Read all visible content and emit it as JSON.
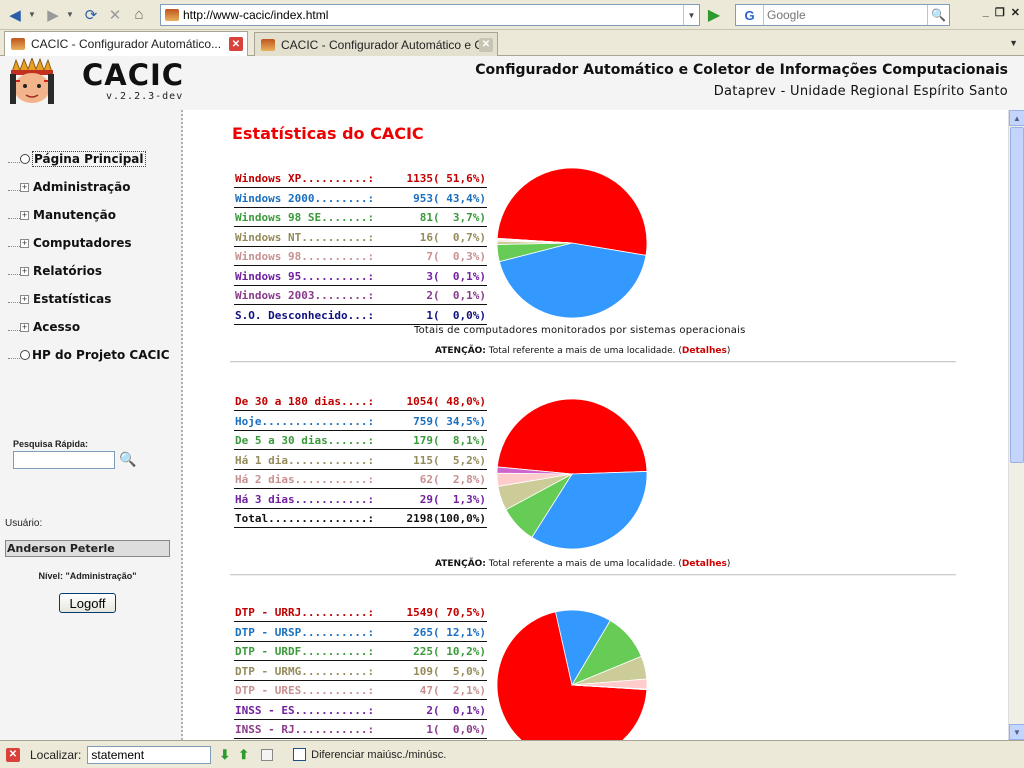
{
  "browser": {
    "url": "http://www-cacic/index.html",
    "search_placeholder": "Google",
    "search_engine_letter": "G",
    "tabs": [
      {
        "label": "CACIC - Configurador Automático...",
        "active": true
      },
      {
        "label": "CACIC - Configurador Automático e C...",
        "active": false
      }
    ]
  },
  "header": {
    "brand": "CACIC",
    "version": "v.2.2.3-dev",
    "title": "Configurador Automático e Coletor de Informações Computacionais",
    "subtitle": "Dataprev - Unidade Regional Espírito Santo"
  },
  "sidebar": {
    "items": [
      {
        "label": "Página Principal",
        "kind": "leaf",
        "selected": true
      },
      {
        "label": "Administração",
        "kind": "expand"
      },
      {
        "label": "Manutenção",
        "kind": "expand"
      },
      {
        "label": "Computadores",
        "kind": "expand"
      },
      {
        "label": "Relatórios",
        "kind": "expand"
      },
      {
        "label": "Estatísticas",
        "kind": "expand"
      },
      {
        "label": "Acesso",
        "kind": "expand"
      },
      {
        "label": "HP do Projeto CACIC",
        "kind": "leaf"
      }
    ],
    "quick_search_label": "Pesquisa Rápida:",
    "user_label": "Usuário:",
    "user_name": "Anderson Peterle",
    "level": "Nível: \"Administração\"",
    "logoff": "Logoff"
  },
  "main": {
    "title": "Estatísticas do CACIC",
    "attention_label": "ATENÇÃO:",
    "attention_text": " Total referente a mais de uma localidade. (",
    "details_link": "Detalhes",
    "attention_close": ")",
    "sections": [
      {
        "caption": "Totais de computadores monitorados por sistemas operacionais",
        "rows": [
          {
            "name": "Windows XP..........:",
            "value": "1135( 51,6%)",
            "color": "#c00000",
            "pct": 51.6
          },
          {
            "name": "Windows 2000........:",
            "value": "953( 43,4%)",
            "color": "#1a6fc0",
            "pct": 43.4
          },
          {
            "name": "Windows 98 SE.......:",
            "value": "81(  3,7%)",
            "color": "#3a9a3a",
            "pct": 3.7
          },
          {
            "name": "Windows NT..........:",
            "value": "16(  0,7%)",
            "color": "#948a5a",
            "pct": 0.7
          },
          {
            "name": "Windows 98..........:",
            "value": "7(  0,3%)",
            "color": "#c89090",
            "pct": 0.3
          },
          {
            "name": "Windows 95..........:",
            "value": "3(  0,1%)",
            "color": "#7020a0",
            "pct": 0.1
          },
          {
            "name": "Windows 2003........:",
            "value": "2(  0,1%)",
            "color": "#8a3a8a",
            "pct": 0.1
          },
          {
            "name": "S.O. Desconhecido...:",
            "value": "1(  0,0%)",
            "color": "#101080",
            "pct": 0.05
          }
        ]
      },
      {
        "caption": "",
        "rows": [
          {
            "name": "De 30 a 180 dias....:",
            "value": "1054( 48,0%)",
            "color": "#c00000",
            "pct": 48.0
          },
          {
            "name": "Hoje................:",
            "value": "759( 34,5%)",
            "color": "#1a6fc0",
            "pct": 34.5
          },
          {
            "name": "De 5 a 30 dias......:",
            "value": "179(  8,1%)",
            "color": "#3a9a3a",
            "pct": 8.1
          },
          {
            "name": "Há 1 dia............:",
            "value": "115(  5,2%)",
            "color": "#948a5a",
            "pct": 5.2
          },
          {
            "name": "Há 2 dias...........:",
            "value": "62(  2,8%)",
            "color": "#c89090",
            "pct": 2.8
          },
          {
            "name": "Há 3 dias...........:",
            "value": "29(  1,3%)",
            "color": "#7020a0",
            "pct": 1.3
          },
          {
            "name": "Total...............:",
            "value": "2198(100,0%)",
            "color": "#111111",
            "pct": null
          }
        ]
      },
      {
        "caption": "",
        "rows": [
          {
            "name": "DTP - URRJ..........:",
            "value": "1549( 70,5%)",
            "color": "#c00000",
            "pct": 70.5
          },
          {
            "name": "DTP - URSP..........:",
            "value": "265( 12,1%)",
            "color": "#1a6fc0",
            "pct": 12.1
          },
          {
            "name": "DTP - URDF..........:",
            "value": "225( 10,2%)",
            "color": "#3a9a3a",
            "pct": 10.2
          },
          {
            "name": "DTP - URMG..........:",
            "value": "109(  5,0%)",
            "color": "#948a5a",
            "pct": 5.0
          },
          {
            "name": "DTP - URES..........:",
            "value": "47(  2,1%)",
            "color": "#c89090",
            "pct": 2.1
          },
          {
            "name": "INSS - ES...........:",
            "value": "2(  0,1%)",
            "color": "#7020a0",
            "pct": 0.1
          },
          {
            "name": "INSS - RJ...........:",
            "value": "1(  0,0%)",
            "color": "#8a3a8a",
            "pct": 0.0
          }
        ]
      }
    ],
    "pie_colors": [
      "#ff0000",
      "#3399ff",
      "#66cc55",
      "#cccc99",
      "#ffcccc",
      "#cc66cc",
      "#9966cc",
      "#333399"
    ]
  },
  "chart_data": [
    {
      "type": "pie",
      "title": "Totais de computadores monitorados por sistemas operacionais",
      "categories": [
        "Windows XP",
        "Windows 2000",
        "Windows 98 SE",
        "Windows NT",
        "Windows 98",
        "Windows 95",
        "Windows 2003",
        "S.O. Desconhecido"
      ],
      "values": [
        1135,
        953,
        81,
        16,
        7,
        3,
        2,
        1
      ]
    },
    {
      "type": "pie",
      "title": "",
      "categories": [
        "De 30 a 180 dias",
        "Hoje",
        "De 5 a 30 dias",
        "Há 1 dia",
        "Há 2 dias",
        "Há 3 dias"
      ],
      "values": [
        1054,
        759,
        179,
        115,
        62,
        29
      ]
    },
    {
      "type": "pie",
      "title": "",
      "categories": [
        "DTP - URRJ",
        "DTP - URSP",
        "DTP - URDF",
        "DTP - URMG",
        "DTP - URES",
        "INSS - ES",
        "INSS - RJ"
      ],
      "values": [
        1549,
        265,
        225,
        109,
        47,
        2,
        1
      ]
    }
  ],
  "findbar": {
    "label": "Localizar:",
    "value": "statement",
    "case_label": "Diferenciar maiúsc./minúsc."
  }
}
